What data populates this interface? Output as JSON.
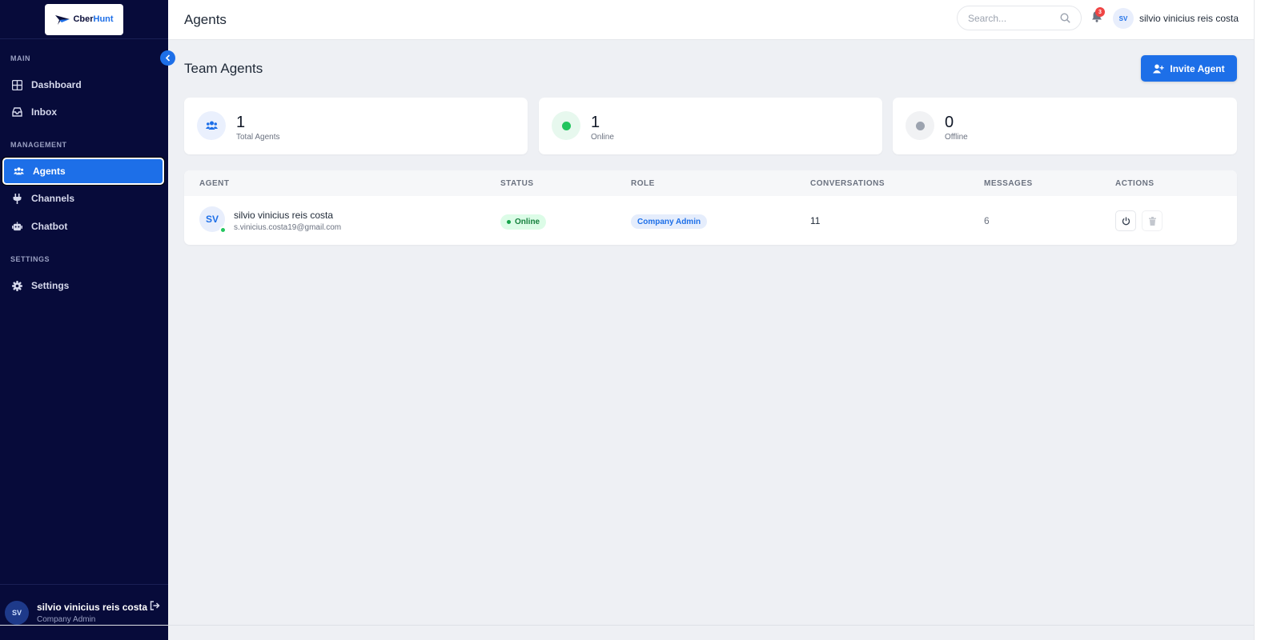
{
  "app": {
    "logo_text_a": "Cber",
    "logo_text_b": "Hunt"
  },
  "sidebar": {
    "sections": {
      "main": "MAIN",
      "management": "MANAGEMENT",
      "settings": "SETTINGS"
    },
    "items": [
      {
        "label": "Dashboard",
        "icon": "grid-icon",
        "active": false
      },
      {
        "label": "Inbox",
        "icon": "inbox-icon",
        "active": false
      },
      {
        "label": "Agents",
        "icon": "users-icon",
        "active": true
      },
      {
        "label": "Channels",
        "icon": "plug-icon",
        "active": false
      },
      {
        "label": "Chatbot",
        "icon": "robot-icon",
        "active": false
      },
      {
        "label": "Settings",
        "icon": "gear-icon",
        "active": false
      }
    ],
    "user": {
      "initials": "SV",
      "name": "silvio vinicius reis costa",
      "role": "Company Admin"
    }
  },
  "header": {
    "title": "Agents",
    "search_placeholder": "Search...",
    "notification_count": "3",
    "user_initials": "SV",
    "user_name": "silvio vinicius reis costa"
  },
  "main": {
    "title": "Team Agents",
    "invite_label": "Invite Agent",
    "stats": [
      {
        "value": "1",
        "label": "Total Agents",
        "icon": "users-icon"
      },
      {
        "value": "1",
        "label": "Online",
        "icon": "online-dot-icon"
      },
      {
        "value": "0",
        "label": "Offline",
        "icon": "offline-dot-icon"
      }
    ],
    "table": {
      "columns": [
        "AGENT",
        "STATUS",
        "ROLE",
        "CONVERSATIONS",
        "MESSAGES",
        "ACTIONS"
      ],
      "rows": [
        {
          "initials": "SV",
          "name": "silvio vinicius reis costa",
          "email": "s.vinicius.costa19@gmail.com",
          "status": "Online",
          "role": "Company Admin",
          "conversations": "11",
          "messages": "6"
        }
      ]
    }
  },
  "colors": {
    "sidebar_bg": "#070b3a",
    "accent": "#1d6fe8",
    "online": "#22c55e",
    "offline": "#9ca3af",
    "badge": "#ef4444"
  }
}
